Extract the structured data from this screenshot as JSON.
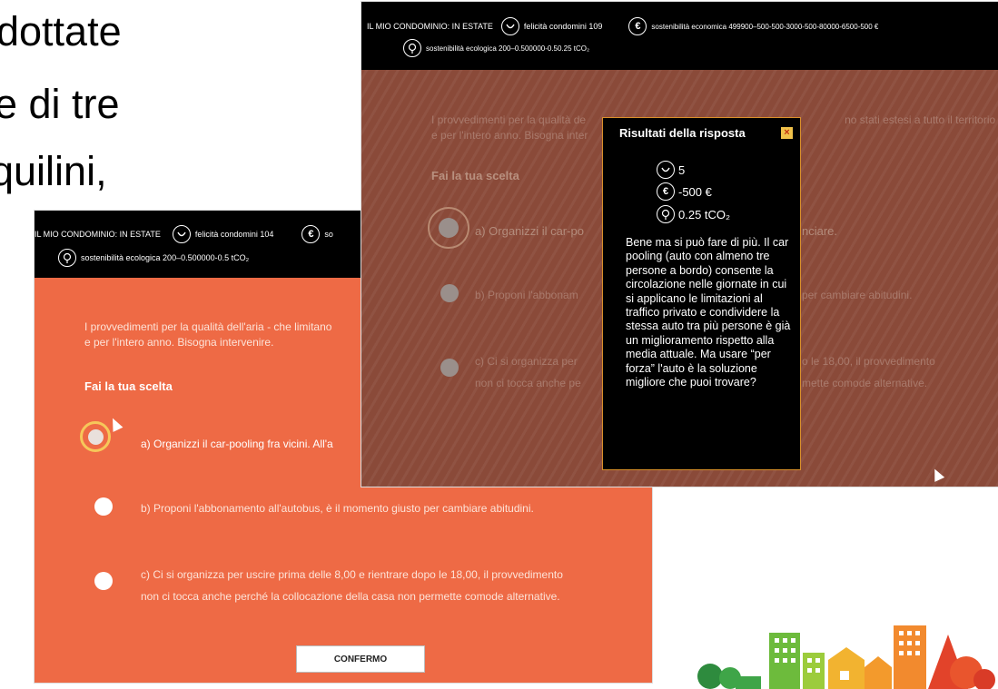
{
  "slide_text": {
    "line1": "dottate",
    "line2": "e di tre",
    "line3": "quilini,"
  },
  "back_screen": {
    "header": {
      "title": "IL MIO CONDOMINIO: IN ESTATE",
      "happiness": "felicità condomini 104",
      "economic_prefix": "so",
      "ecological": "sostenibilità ecologica 200–0.500000-0.5 tCO₂"
    },
    "intro_line1": "I provvedimenti per la qualità dell'aria - che limitano",
    "intro_line2": "e per l'intero anno. Bisogna intervenire.",
    "choose": "Fai la tua scelta",
    "options": [
      "a) Organizzi il car-pooling fra vicini. All'a",
      "b) Proponi l'abbonamento all'autobus, è il momento giusto per cambiare abitudini.",
      "c) Ci si organizza per uscire prima delle 8,00 e rientrare dopo le 18,00, il provvedimento",
      "non ci tocca anche perché la collocazione della casa non permette comode alternative."
    ],
    "confirm": "CONFERMO",
    "colors": {
      "panel": "#ee6a45",
      "ring": "#f6c75a"
    }
  },
  "front_screen": {
    "header": {
      "title": "IL MIO CONDOMINIO: IN ESTATE",
      "happiness": "felicità condomini 109",
      "economic": "sostenibilità economica 499900–500-500-3000-500-80000-6500-500 €",
      "ecological": "sostenibilità ecologica 200–0.500000-0.50.25 tCO₂"
    },
    "intro_line1a": "I provvedimenti per la qualità de",
    "intro_line1b": "no stati estesi a tutto il territorio",
    "intro_line2": "e per l'intero anno. Bisogna inter",
    "choose": "Fai la tua scelta",
    "opt_a_left": "a) Organizzi il car-po",
    "opt_a_right": "nciare.",
    "opt_b_left": "b) Proponi l'abbonam",
    "opt_b_right": "per cambiare abitudini.",
    "opt_c_left1": "c) Ci si organizza per",
    "opt_c_right1": "o le 18,00, il provvedimento",
    "opt_c_left2": "non ci tocca anche pe",
    "opt_c_right2": "mette comode alternative."
  },
  "popup": {
    "title": "Risultati della risposta",
    "close": "×",
    "happiness": "5",
    "economy": "-500 €",
    "ecology": "0.25 tCO₂",
    "body": "Bene ma si può fare di più. Il car pooling (auto con almeno tre persone a bordo) consente la circolazione nelle giornate in cui si applicano le limitazioni al traffico privato e condividere la stessa auto tra più persone è già un miglioramento rispetto alla media attuale. Ma usare “per forza” l'auto è la soluzione migliore che puoi trovare?"
  },
  "icons": {
    "happiness": "smile-icon",
    "economy": "euro-icon",
    "ecology": "tree-icon"
  }
}
